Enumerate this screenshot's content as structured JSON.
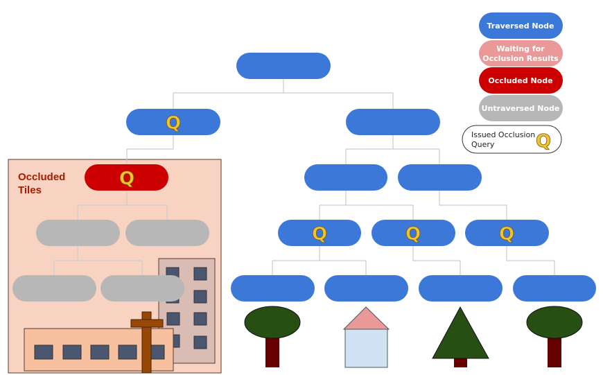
{
  "colors": {
    "traversed": "#3c78d8",
    "waiting": "#ea9999",
    "occluded": "#cc0000",
    "untraversed": "#b7b7b7",
    "occluded_region": "#f8d3c2",
    "query_glyph": "#f1c232"
  },
  "query_glyph": "Q",
  "occluded_region": {
    "label_line1": "Occluded",
    "label_line2": "Tiles"
  },
  "legend": {
    "traversed": "Traversed Node",
    "waiting_line1": "Waiting for",
    "waiting_line2": "Occlusion Results",
    "occluded": "Occluded Node",
    "untraversed": "Untraversed Node",
    "query_line1": "Issued Occlusion",
    "query_line2": "Query"
  },
  "tree": {
    "nodes": [
      {
        "id": "root",
        "state": "traversed",
        "query": false
      },
      {
        "id": "l1-left",
        "state": "traversed",
        "query": true
      },
      {
        "id": "l1-right",
        "state": "traversed",
        "query": false
      },
      {
        "id": "l2-occluded",
        "state": "occluded",
        "query": true
      },
      {
        "id": "l2-right-a",
        "state": "traversed",
        "query": false
      },
      {
        "id": "l2-right-b",
        "state": "traversed",
        "query": false
      },
      {
        "id": "l3-grey-a",
        "state": "untraversed",
        "query": false
      },
      {
        "id": "l3-grey-b",
        "state": "untraversed",
        "query": false
      },
      {
        "id": "l3-blue-a",
        "state": "traversed",
        "query": true
      },
      {
        "id": "l3-blue-b",
        "state": "traversed",
        "query": true
      },
      {
        "id": "l3-blue-c",
        "state": "traversed",
        "query": true
      },
      {
        "id": "l4-grey-a",
        "state": "untraversed",
        "query": false
      },
      {
        "id": "l4-grey-b",
        "state": "untraversed",
        "query": false
      },
      {
        "id": "l4-blue-a",
        "state": "traversed",
        "query": false
      },
      {
        "id": "l4-blue-b",
        "state": "traversed",
        "query": false
      },
      {
        "id": "l4-blue-c",
        "state": "traversed",
        "query": false
      },
      {
        "id": "l4-blue-d",
        "state": "traversed",
        "query": false
      }
    ]
  },
  "scene_objects": [
    "tall-building",
    "wide-building",
    "utility-pole",
    "round-tree",
    "house",
    "pine-tree",
    "round-tree"
  ]
}
